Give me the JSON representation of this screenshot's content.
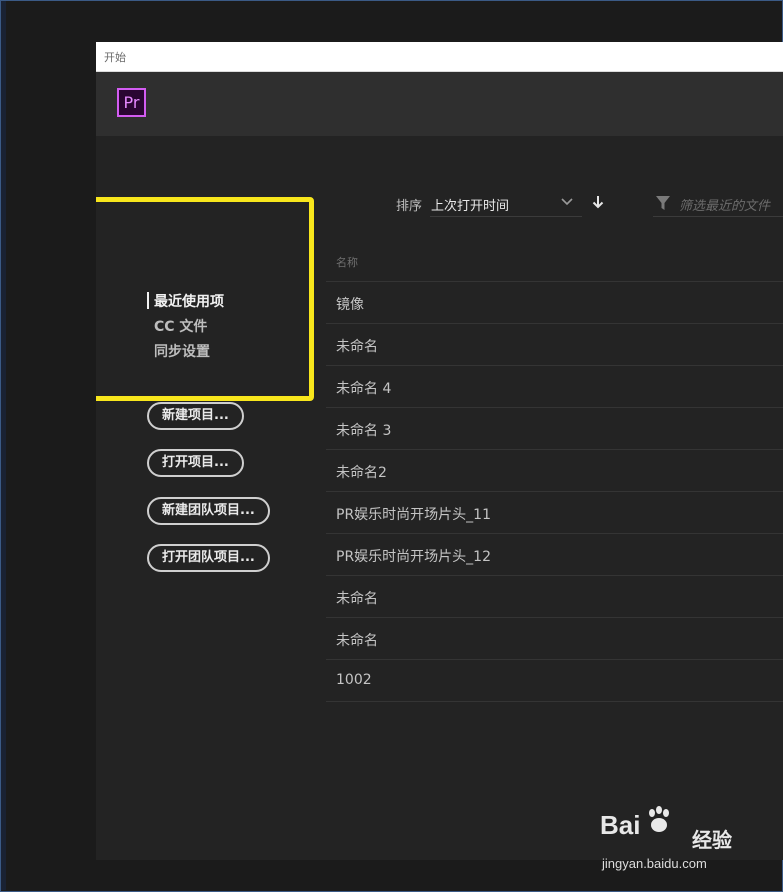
{
  "window": {
    "title": "开始"
  },
  "app": {
    "logo_text": "Pr",
    "accent": "#d35cf2"
  },
  "nav": {
    "items": [
      {
        "label": "最近使用项",
        "active": true
      },
      {
        "label": "CC 文件",
        "active": false
      },
      {
        "label": "同步设置",
        "active": false
      }
    ],
    "actions": [
      {
        "label": "新建项目..."
      },
      {
        "label": "打开项目..."
      },
      {
        "label": "新建团队项目..."
      },
      {
        "label": "打开团队项目..."
      }
    ]
  },
  "sort": {
    "label": "排序",
    "value": "上次打开时间",
    "chevron_icon": "chevron-down-icon",
    "direction_icon": "arrow-down-icon"
  },
  "filter": {
    "placeholder": "筛选最近的文件",
    "icon": "filter-icon"
  },
  "table": {
    "column_header": "名称",
    "rows": [
      "镜像",
      "未命名",
      "未命名 4",
      "未命名 3",
      "未命名2",
      "PR娱乐时尚开场片头_11",
      "PR娱乐时尚开场片头_12",
      "未命名",
      "未命名",
      "1002"
    ]
  },
  "highlight": {
    "color": "#f8e61c"
  },
  "watermark": {
    "brand_a": "Bai",
    "brand_b": "经验",
    "url": "jingyan.baidu.com"
  }
}
